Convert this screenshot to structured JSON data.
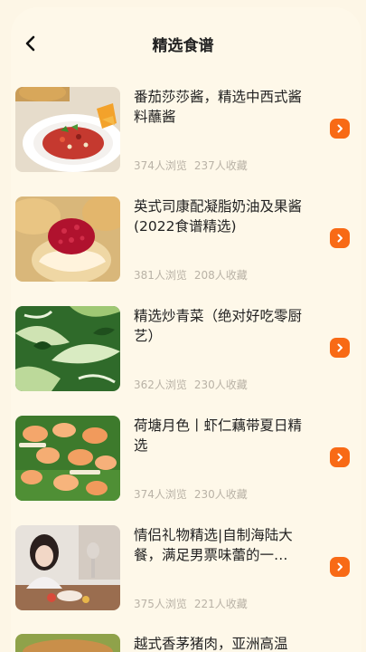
{
  "header": {
    "back_icon": "chevron-left-icon",
    "title": "精选食谱"
  },
  "colors": {
    "background": "#fdf6e6",
    "accent": "#f86a16",
    "meta_text": "#b9b2a6",
    "title_text": "#222222"
  },
  "recipes": [
    {
      "title": "番茄莎莎酱，精选中西式酱料蘸酱",
      "views": "374人浏览",
      "favorites": "237人收藏"
    },
    {
      "title": "英式司康配凝脂奶油及果酱(2022食谱精选)",
      "views": "381人浏览",
      "favorites": "208人收藏"
    },
    {
      "title": "精选炒青菜（绝对好吃零厨艺）",
      "views": "362人浏览",
      "favorites": "230人收藏"
    },
    {
      "title": "荷塘月色丨虾仁藕带夏日精选",
      "views": "374人浏览",
      "favorites": "230人收藏"
    },
    {
      "title": "情侣礼物精选|自制海陆大餐，满足男票味蕾的一…",
      "views": "375人浏览",
      "favorites": "221人收藏"
    }
  ],
  "partial_recipe": {
    "title": "越式香茅猪肉，亚洲高温"
  }
}
